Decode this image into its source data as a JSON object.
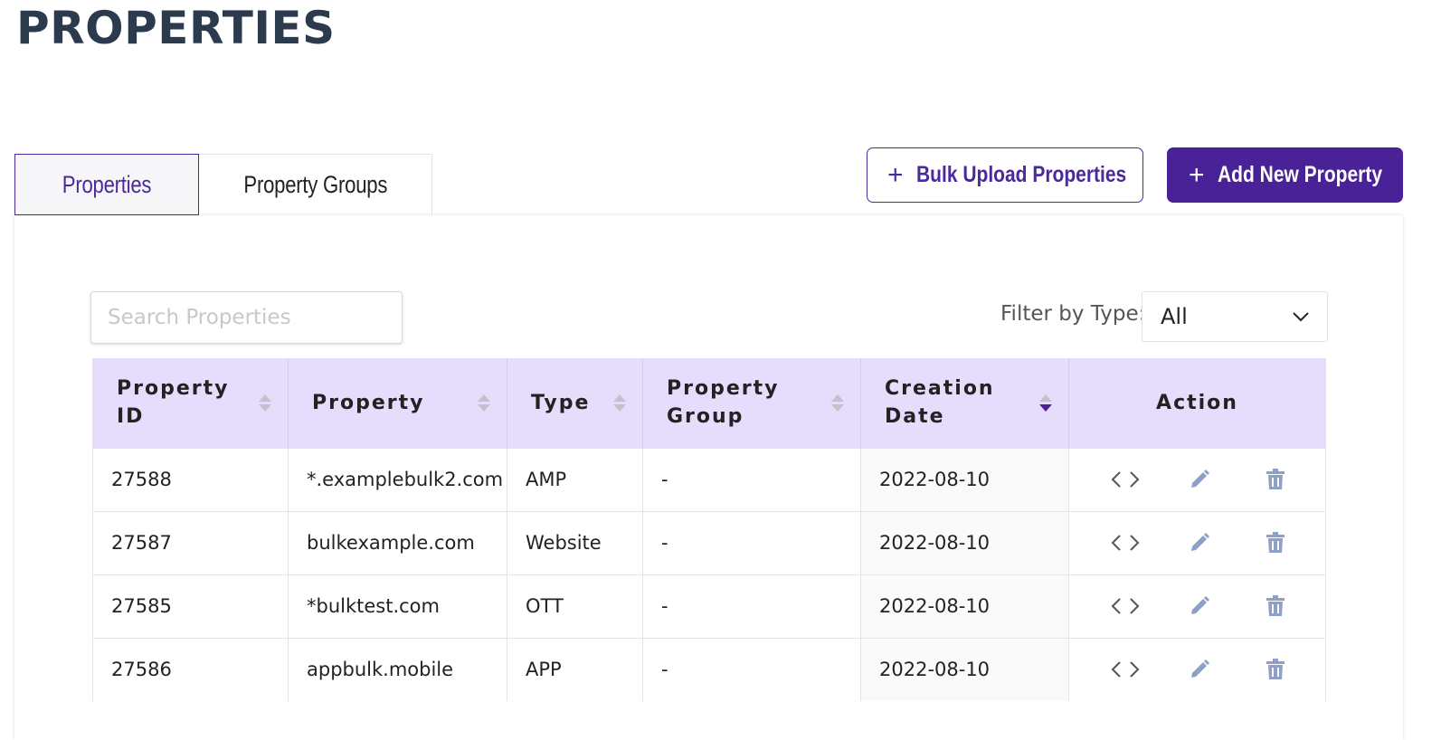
{
  "page": {
    "title": "PROPERTIES"
  },
  "tabs": [
    {
      "label": "Properties",
      "active": true
    },
    {
      "label": "Property Groups",
      "active": false
    }
  ],
  "buttons": {
    "bulk_upload": "Bulk Upload Properties",
    "add_new": "Add New Property"
  },
  "search": {
    "placeholder": "Search Properties",
    "value": ""
  },
  "filter": {
    "label": "Filter by Type:",
    "selected": "All"
  },
  "table": {
    "columns": [
      "Property ID",
      "Property",
      "Type",
      "Property Group",
      "Creation Date",
      "Action"
    ],
    "sort": {
      "column": "Creation Date",
      "direction": "descending"
    },
    "rows": [
      {
        "id": "27588",
        "property": "*.examplebulk2.com",
        "type": "AMP",
        "group": "-",
        "date": "2022-08-10"
      },
      {
        "id": "27587",
        "property": "bulkexample.com",
        "type": "Website",
        "group": "-",
        "date": "2022-08-10"
      },
      {
        "id": "27585",
        "property": "*bulktest.com",
        "type": "OTT",
        "group": "-",
        "date": "2022-08-10"
      },
      {
        "id": "27586",
        "property": "appbulk.mobile",
        "type": "APP",
        "group": "-",
        "date": "2022-08-10"
      }
    ]
  },
  "icons": {
    "code": "code-icon",
    "edit": "pencil-icon",
    "delete": "trash-icon",
    "plus": "plus-icon",
    "dropdown": "chevron-down-icon"
  },
  "colors": {
    "primary": "#4a2297",
    "header_bg": "#e6ddfc",
    "title": "#2b3a4c",
    "icon": "#8fa0c8"
  }
}
